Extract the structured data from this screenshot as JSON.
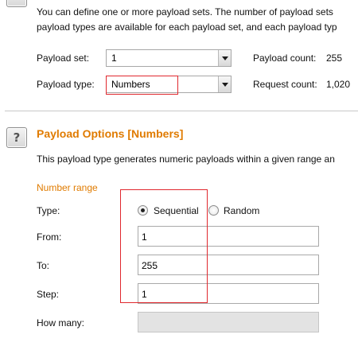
{
  "payload_sets_section": {
    "description_line1": "You can define one or more payload sets. The number of payload sets",
    "description_line2": "payload types are available for each payload set, and each payload typ",
    "payload_set": {
      "label": "Payload set:",
      "value": "1"
    },
    "payload_type": {
      "label": "Payload type:",
      "value": "Numbers"
    },
    "payload_count": {
      "label": "Payload count:",
      "value": "255"
    },
    "request_count": {
      "label": "Request count:",
      "value": "1,020"
    }
  },
  "payload_options_section": {
    "help_icon_glyph": "?",
    "title": "Payload Options [Numbers]",
    "description": "This payload type generates numeric payloads within a given range an",
    "number_range_heading": "Number range",
    "type": {
      "label": "Type:",
      "options": [
        {
          "label": "Sequential",
          "selected": true
        },
        {
          "label": "Random",
          "selected": false
        }
      ]
    },
    "from": {
      "label": "From:",
      "value": "1"
    },
    "to": {
      "label": "To:",
      "value": "255"
    },
    "step": {
      "label": "Step:",
      "value": "1"
    },
    "how_many": {
      "label": "How many:",
      "value": ""
    }
  },
  "colors": {
    "heading_accent": "#e07b00",
    "highlight_box": "#e0282e"
  }
}
